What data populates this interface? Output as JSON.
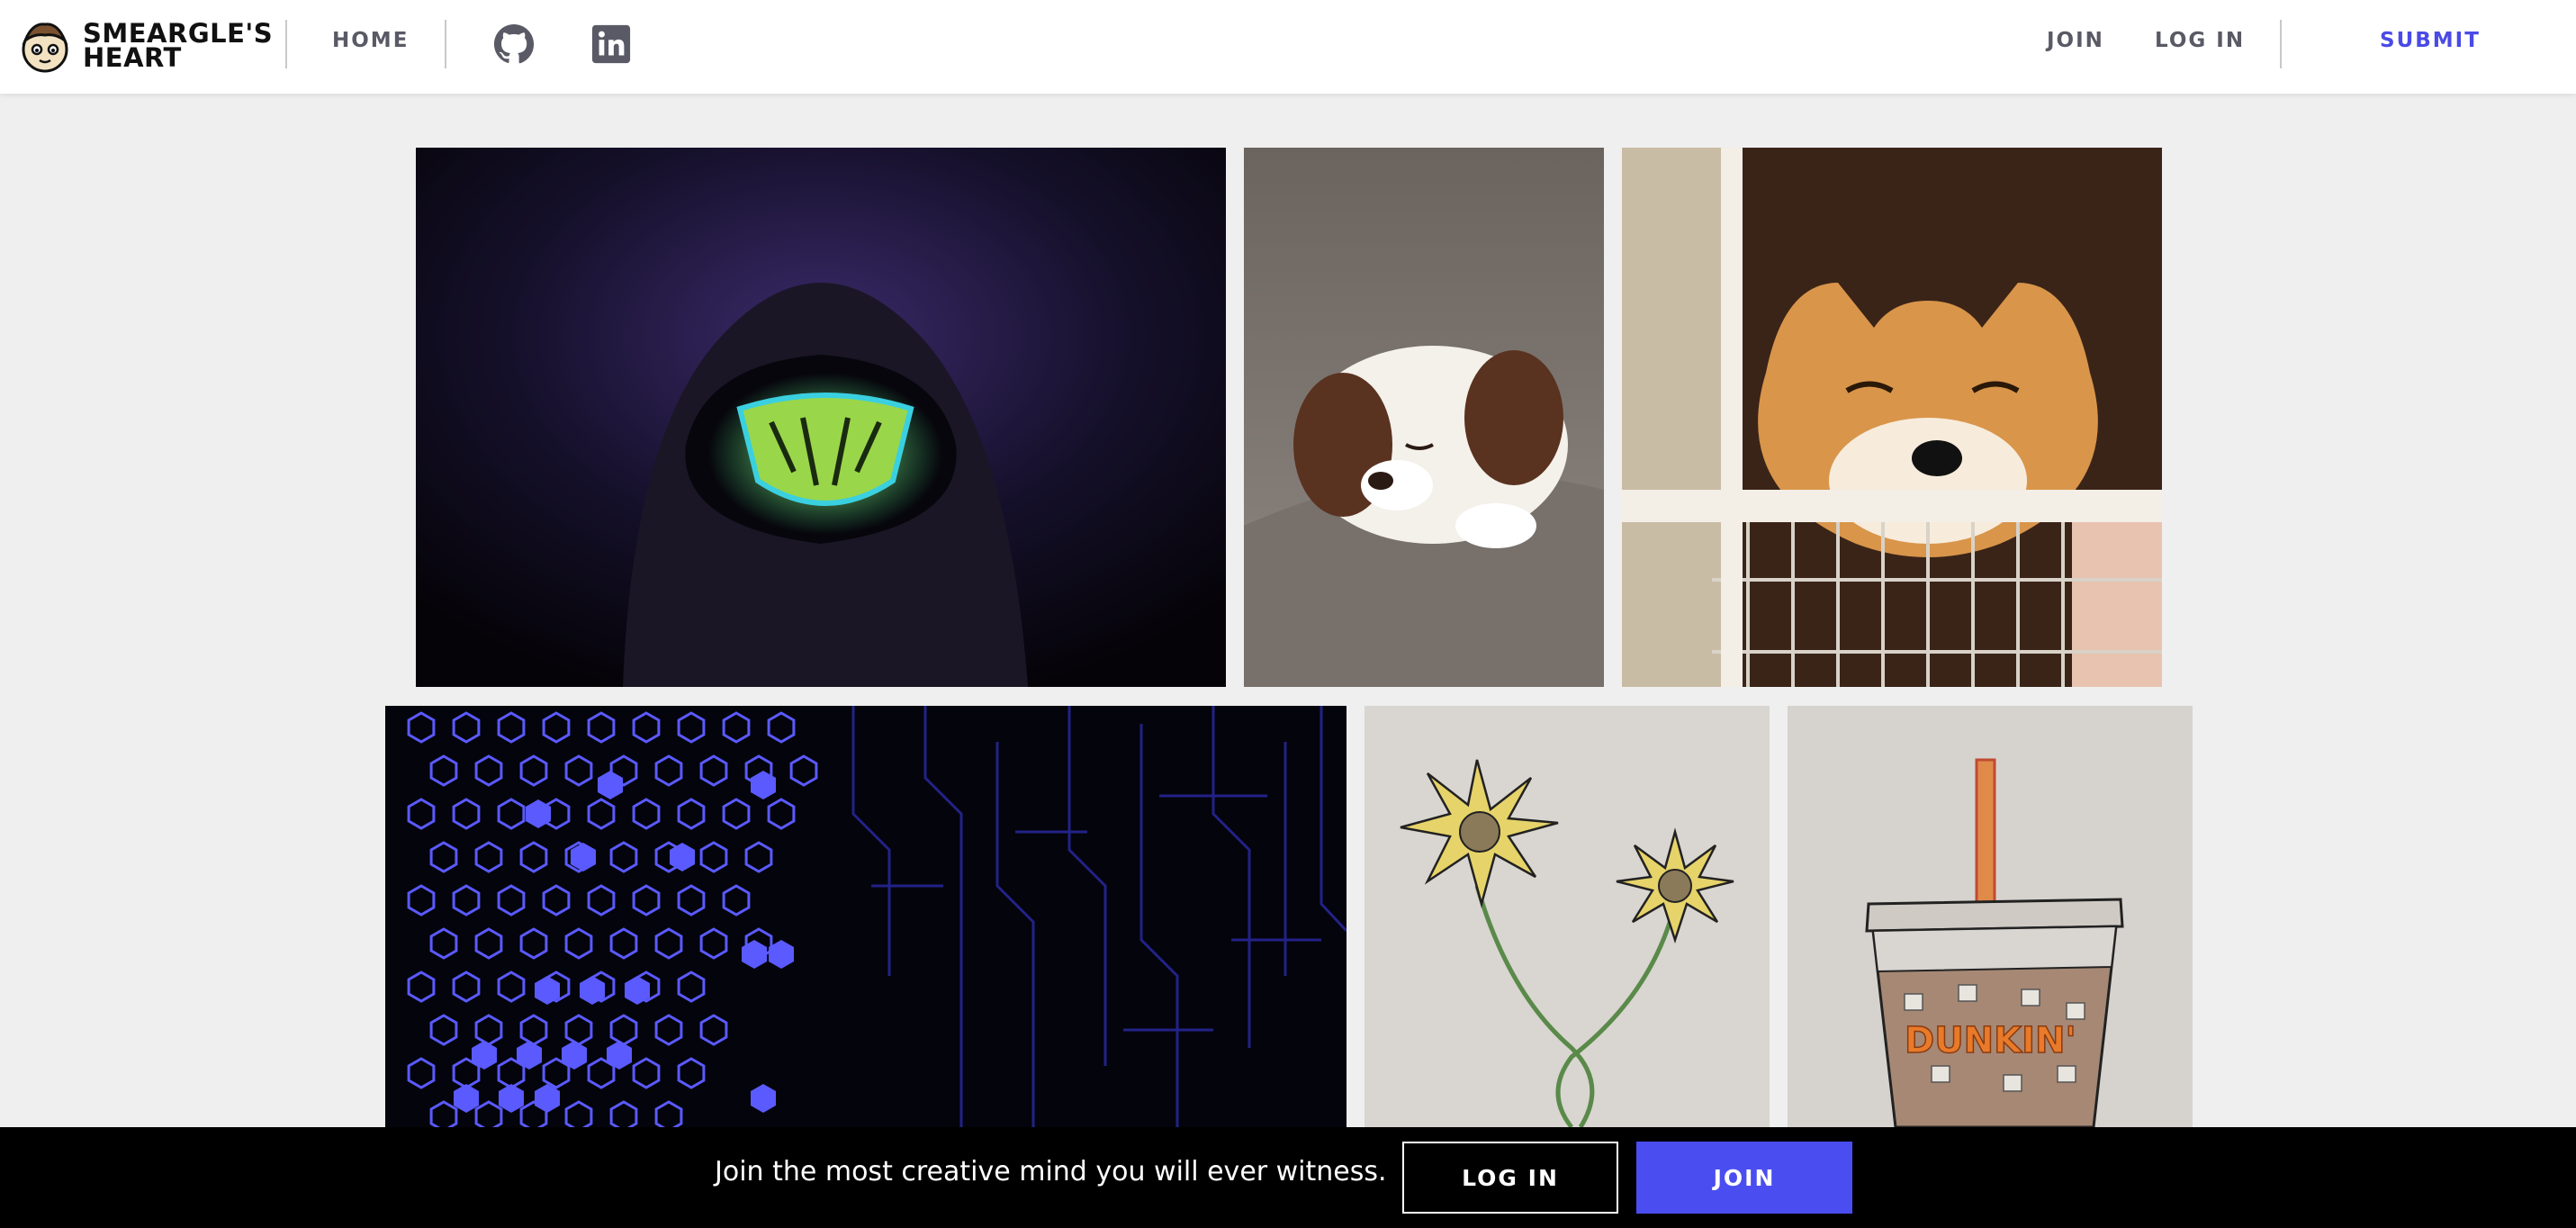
{
  "header": {
    "logo_text": "SMEARGLE'S\nHEART",
    "nav": {
      "home": "HOME",
      "join": "JOIN",
      "login": "LOG IN",
      "submit": "SUBMIT"
    },
    "icons": [
      "github-icon",
      "linkedin-icon"
    ]
  },
  "gallery": [
    {
      "subject": "hooded-figure-with-glowing-mask"
    },
    {
      "subject": "sleeping-puppy"
    },
    {
      "subject": "smiling-shiba-inu"
    },
    {
      "subject": "blue-hexagon-circuit-pattern"
    },
    {
      "subject": "sunflower-drawing"
    },
    {
      "subject": "iced-coffee-drawing",
      "label": "DUNKIN'"
    }
  ],
  "bottom_bar": {
    "message": "Join the most creative mind you will ever witness.",
    "login_label": "LOG IN",
    "join_label": "JOIN"
  },
  "colors": {
    "accent": "#4a4ef0",
    "header_bg": "#ffffff",
    "page_bg": "#efefef",
    "bottom_bar_bg": "#000000"
  }
}
